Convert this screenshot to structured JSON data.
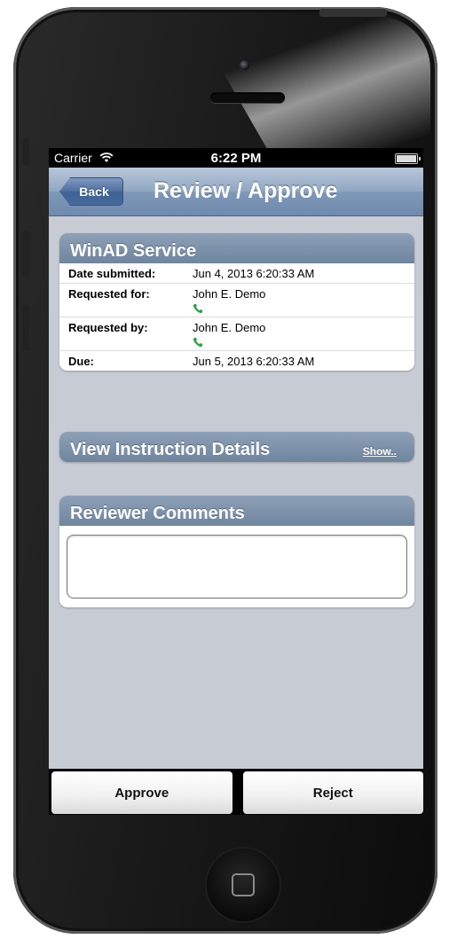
{
  "status_bar": {
    "carrier": "Carrier",
    "time": "6:22 PM"
  },
  "nav": {
    "back_label": "Back",
    "title": "Review / Approve"
  },
  "service_card": {
    "title": "WinAD Service",
    "rows": [
      {
        "label": "Date submitted:",
        "value": "Jun 4, 2013 6:20:33 AM",
        "has_phone": false
      },
      {
        "label": "Requested for:",
        "value": "John E. Demo",
        "has_phone": true
      },
      {
        "label": "Requested by:",
        "value": "John E. Demo",
        "has_phone": true
      },
      {
        "label": "Due:",
        "value": "Jun 5, 2013 6:20:33 AM",
        "has_phone": false
      }
    ]
  },
  "instruction_card": {
    "title": "View Instruction Details",
    "show_label": "Show.."
  },
  "comments_card": {
    "title": "Reviewer Comments",
    "value": ""
  },
  "toolbar": {
    "approve_label": "Approve",
    "reject_label": "Reject"
  },
  "colors": {
    "nav_bar": "#7f98b8",
    "screen_background": "#c7ccd4",
    "card_header": "#7a8ea6",
    "phone_icon": "#2ea043"
  },
  "icons": [
    "wifi-icon",
    "battery-icon",
    "phone-icon",
    "home-button-icon"
  ]
}
